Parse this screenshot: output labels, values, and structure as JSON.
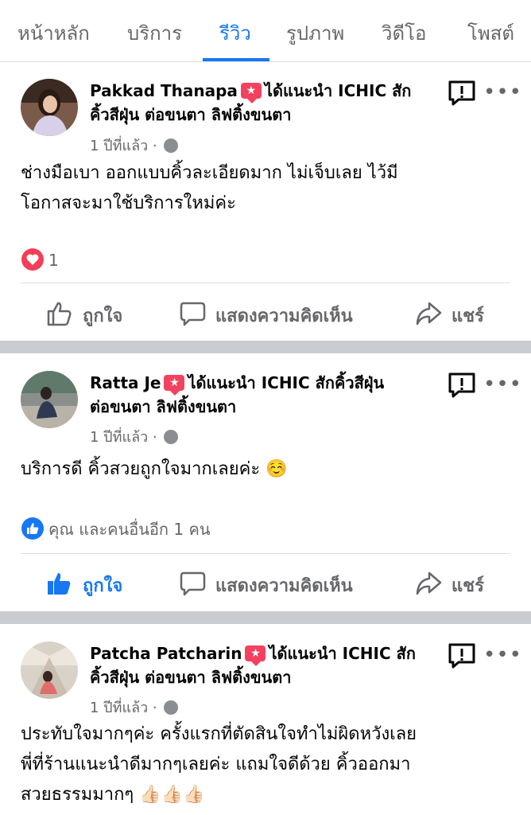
{
  "tabs": [
    {
      "label": "หน้าหลัก",
      "active": false
    },
    {
      "label": "บริการ",
      "active": false
    },
    {
      "label": "รีวิว",
      "active": true
    },
    {
      "label": "รูปภาพ",
      "active": false
    },
    {
      "label": "วิดีโอ",
      "active": false
    },
    {
      "label": "โพสต์",
      "active": false
    }
  ],
  "accent_color": "#1877f2",
  "posts": [
    {
      "author": "Pakkad Thanapa",
      "recommends_prefix": "ได้แนะนำ",
      "line1": "ได้แนะนำ ICHIC สัก",
      "line2": "คิ้วสีฝุ่น ต่อขนตา ลิฟติ้งขนตา",
      "time": "1 ปีที่แล้ว ·",
      "text_line1": "ช่างมือเบา ออกแบบคิ้วละเอียดมาก ไม่เจ็บเลย ไว้มี",
      "text_line2": "โอกาสจะมาใช้บริการใหม่ค่ะ",
      "text_line3": "",
      "reaction_icon": "heart-icon",
      "reaction_text": "1",
      "liked": false
    },
    {
      "author": "Ratta Je",
      "recommends_prefix": "ได้แนะนำ",
      "line1": "ได้แนะนำ ICHIC สักคิ้วสีฝุ่น",
      "line2": "ต่อขนตา ลิฟติ้งขนตา",
      "time": "1 ปีที่แล้ว ·",
      "text_line1": "บริการดี คิ้วสวยถูกใจมากเลยค่ะ ☺️",
      "text_line2": "",
      "text_line3": "",
      "reaction_icon": "like-icon",
      "reaction_text": "คุณ และคนอื่นอีก 1 คน",
      "liked": true
    },
    {
      "author": "Patcha Patcharin",
      "recommends_prefix": "ได้แนะนำ",
      "line1": "ได้แนะนำ ICHIC สัก",
      "line2": "คิ้วสีฝุ่น ต่อขนตา ลิฟติ้งขนตา",
      "time": "1 ปีที่แล้ว ·",
      "text_line1": "ประทับใจมากๆค่ะ ครั้งแรกที่ตัดสินใจทำไม่ผิดหวังเลย",
      "text_line2": "พี่ที่ร้านแนะนำดีมากๆเลยค่ะ แถมใจดีด้วย คิ้วออกมา",
      "text_line3": "สวยธรรมมากๆ 👍🏻👍🏻👍🏻"
    }
  ],
  "actions": {
    "like": "ถูกใจ",
    "comment": "แสดงความคิดเห็น",
    "share": "แชร์"
  }
}
